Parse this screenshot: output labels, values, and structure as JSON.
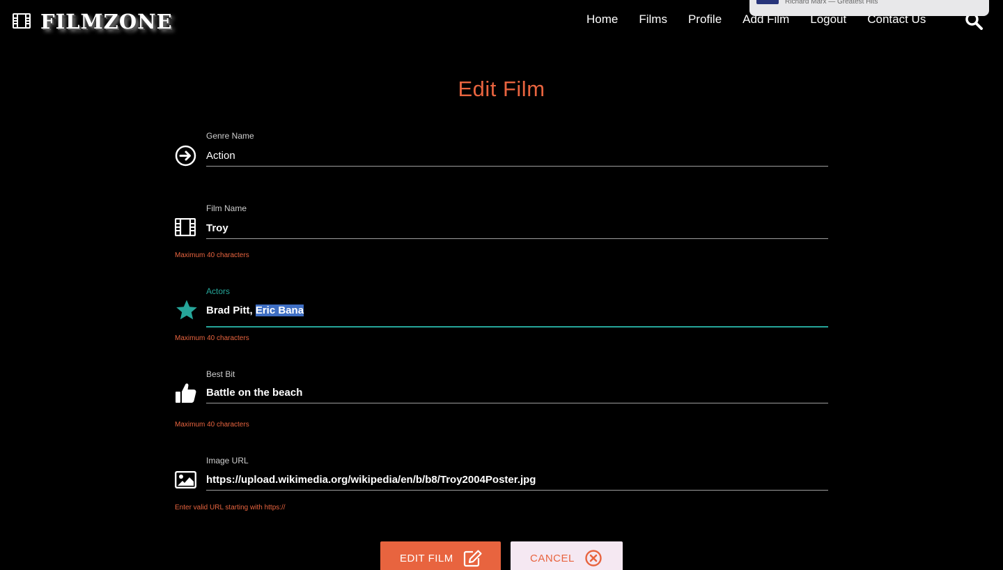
{
  "brand": {
    "name": "FILMZONE",
    "icon": "film-icon"
  },
  "nav": {
    "links": [
      "Home",
      "Films",
      "Profile",
      "Add Film",
      "Logout",
      "Contact Us"
    ],
    "search_icon": "search-icon"
  },
  "music_popup": {
    "text": "Richard Marx — Greatest Hits"
  },
  "page": {
    "title": "Edit Film"
  },
  "form": {
    "genre": {
      "label": "Genre Name",
      "value": "Action",
      "icon": "arrow-right-circle-icon"
    },
    "film_name": {
      "label": "Film Name",
      "value": "Troy",
      "helper": "Maximum 40 characters",
      "icon": "film-icon"
    },
    "actors": {
      "label": "Actors",
      "value_prefix": "Brad Pitt, ",
      "value_selected": "Eric Bana",
      "helper": "Maximum 40 characters",
      "icon": "star-icon"
    },
    "best_bit": {
      "label": "Best Bit",
      "value": "Battle on the beach",
      "helper": "Maximum 40 characters",
      "icon": "thumbs-up-icon"
    },
    "image_url": {
      "label": "Image URL",
      "value": "https://upload.wikimedia.org/wikipedia/en/b/b8/Troy2004Poster.jpg",
      "helper": "Enter valid URL starting with https://",
      "icon": "image-icon"
    }
  },
  "buttons": {
    "edit": "EDIT FILM",
    "cancel": "CANCEL"
  },
  "colors": {
    "accent": "#e8643f",
    "active": "#26a69a",
    "background": "#000000"
  }
}
